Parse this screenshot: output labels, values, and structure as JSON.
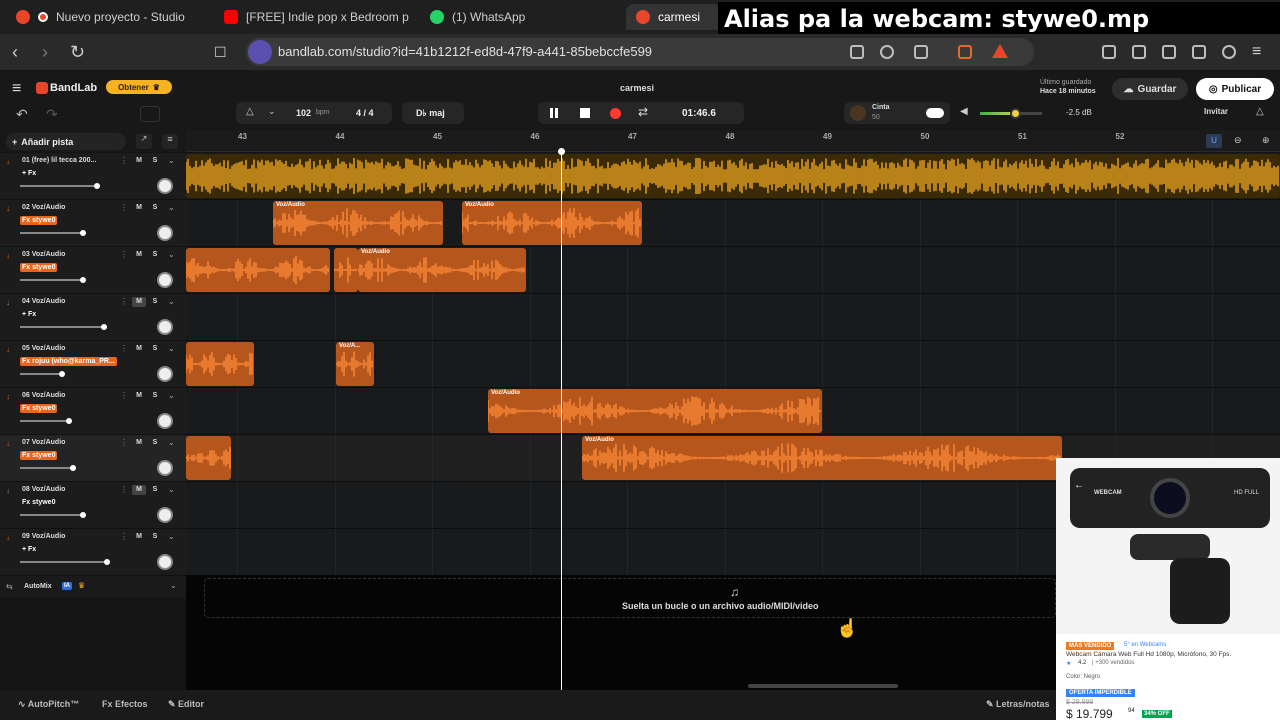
{
  "tabs": [
    {
      "label": "Nuevo proyecto - Studio",
      "favicon": "bandlab-icon"
    },
    {
      "label": "[FREE] Indie pop x Bedroom p",
      "favicon": "youtube-icon"
    },
    {
      "label": "(1) WhatsApp",
      "favicon": "whatsapp-icon"
    },
    {
      "label": "carmesi",
      "favicon": "bandlab-icon"
    }
  ],
  "overlay_text": "Alias pa la webcam: stywe0.mp",
  "url": "bandlab.com/studio?id=41b1212f-ed8d-47f9-a441-85bebccfe599",
  "app": {
    "logo": "BandLab",
    "obtener": "Obtener",
    "project_name": "carmesi",
    "saved_line1": "Último guardado",
    "saved_line2": "Hace 18 minutos",
    "save_label": "Guardar",
    "publish_label": "Publicar",
    "invite_label": "Invitar"
  },
  "transport": {
    "bpm": "102",
    "bpm_unit": "bpm",
    "time_sig": "4 / 4",
    "key": "D♭ maj",
    "time": "01:46.6",
    "tape_label": "Cinta",
    "tape_value": "50",
    "volume_db": "-2.5 dB",
    "master_volume_fraction": 0.58
  },
  "add_track_label": "Añadir pista",
  "ruler": [
    "43",
    "44",
    "45",
    "46",
    "47",
    "48",
    "49",
    "50",
    "51",
    "52"
  ],
  "tracks": [
    {
      "name": "01  (free) lil tecca  200...",
      "fx": "+ Fx",
      "fx_style": "plain",
      "volume": 0.55,
      "muted": false
    },
    {
      "name": "02  Voz/Audio",
      "fx": "Fx stywe0",
      "fx_style": "orange",
      "volume": 0.45,
      "muted": false
    },
    {
      "name": "03  Voz/Audio",
      "fx": "Fx stywe0",
      "fx_style": "orange",
      "volume": 0.45,
      "muted": false
    },
    {
      "name": "04  Voz/Audio",
      "fx": "+ Fx",
      "fx_style": "plain",
      "volume": 0.6,
      "muted": true
    },
    {
      "name": "05  Voz/Audio",
      "fx": "Fx rojuu (who@karma_PR...",
      "fx_style": "orange",
      "volume": 0.3,
      "muted": false
    },
    {
      "name": "06  Voz/Audio",
      "fx": "Fx stywe0",
      "fx_style": "orange",
      "volume": 0.35,
      "muted": false
    },
    {
      "name": "07  Voz/Audio",
      "fx": "Fx stywe0",
      "fx_style": "orange",
      "volume": 0.38,
      "muted": false
    },
    {
      "name": "08  Voz/Audio",
      "fx": "Fx stywe0",
      "fx_style": "plain",
      "volume": 0.45,
      "muted": true
    },
    {
      "name": "09  Voz/Audio",
      "fx": "+ Fx",
      "fx_style": "plain",
      "volume": 0.62,
      "muted": false
    }
  ],
  "clip_label": "Voz/Audio",
  "clip_label_short": "Voz/A...",
  "automix_label": "AutoMix",
  "automix_badge": "IA",
  "drop_text": "Suelta un bucle o un archivo audio/MIDI/video",
  "bottom": {
    "autopitch": "AutoPitch™",
    "efectos": "Efectos",
    "editor": "Editor",
    "lyrics": "Letras/notas"
  },
  "ad": {
    "image_label": "WEBCAM",
    "hd_label": "HD FULL",
    "badge": "MÁS VENDIDO",
    "rank": "5° en Webcams",
    "title": "Webcam Cámara Web Full Hd 1080p, Micrófono, 30 Fps.",
    "rating": "4.2",
    "sold": "| +300 vendidos",
    "color": "Color: Negro",
    "offer": "OFERTA IMPERDIBLE",
    "old_price": "$ 29.999",
    "price": "$ 19.799",
    "cents": "94",
    "discount": "34% OFF"
  },
  "colors": {
    "accent_orange": "#e8651a",
    "beat_yellow": "#f0a820",
    "clip_bg": "#b5561c",
    "record_red": "#ff3b30"
  }
}
